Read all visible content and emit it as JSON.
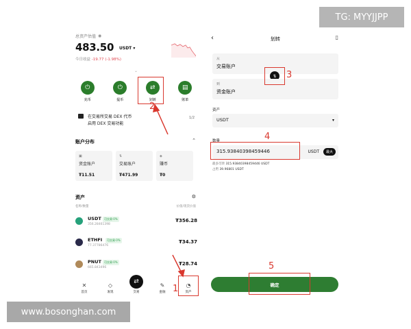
{
  "left": {
    "assets_label": "总资产估值",
    "balance": "483.50",
    "balance_unit": "USDT",
    "today_pnl_label": "今日收益",
    "today_pnl_value": "-19.77 (-1.98%)",
    "actions": [
      {
        "label": "充币",
        "icon": "deposit-icon"
      },
      {
        "label": "提币",
        "icon": "withdraw-icon"
      },
      {
        "label": "划转",
        "icon": "transfer-icon"
      },
      {
        "label": "账单",
        "icon": "bill-icon"
      }
    ],
    "dex": {
      "line1": "在交易所交易 DEX 代币",
      "line2": "启用 DEX 交易功能",
      "pager": "1/2"
    },
    "account_section_title": "账户分布",
    "accounts": [
      {
        "name": "资金账户",
        "value": "₮11.51"
      },
      {
        "name": "交易账户",
        "value": "₮471.99"
      },
      {
        "name": "赚币",
        "value": "₮0"
      }
    ],
    "asset_section_title": "资产",
    "asset_cols": {
      "left": "名称/数量",
      "right": "价值/现货价值"
    },
    "assets": [
      {
        "symbol": "USDT",
        "tag": "可交易·0%",
        "sub": "356.28461398",
        "amount": "₮356.28",
        "color": "#26a17b"
      },
      {
        "symbol": "ETHFI",
        "tag": "可交易·0%",
        "sub": "77.37786476",
        "amount": "₮34.37",
        "color": "#2a2a4a"
      },
      {
        "symbol": "PNUT",
        "tag": "可交易·0%",
        "sub": "665.843496",
        "amount": "₮28.74",
        "color": "#b08a5a"
      }
    ],
    "nav": [
      {
        "label": "首页",
        "icon": "home-icon"
      },
      {
        "label": "发现",
        "icon": "discover-icon"
      },
      {
        "label": "交易",
        "icon": "trade-icon"
      },
      {
        "label": "金融",
        "icon": "finance-icon"
      },
      {
        "label": "资产",
        "icon": "assets-icon"
      }
    ]
  },
  "right": {
    "title": "划转",
    "from_label": "从",
    "from_value": "交易账户",
    "to_label": "到",
    "to_value": "资金账户",
    "asset_label": "资产",
    "asset_value": "USDT",
    "amount_label": "数量",
    "amount_value": "315.93840398459446",
    "amount_unit": "USDT",
    "max_label": "最大",
    "info1_label": "最多可转",
    "info1_value": "315.93840398459446 USDT",
    "info2_label": "占用",
    "info2_value": "39.96801 USDT",
    "confirm_label": "确定"
  },
  "annotations": [
    "1",
    "2",
    "3",
    "4",
    "5"
  ],
  "watermarks": {
    "tg": "TG: MYYJJPP",
    "site": "www.bosonghan.com"
  },
  "colors": {
    "accent_green": "#2e7d32",
    "annotation_red": "#d9382e",
    "negative": "#e0464f"
  }
}
